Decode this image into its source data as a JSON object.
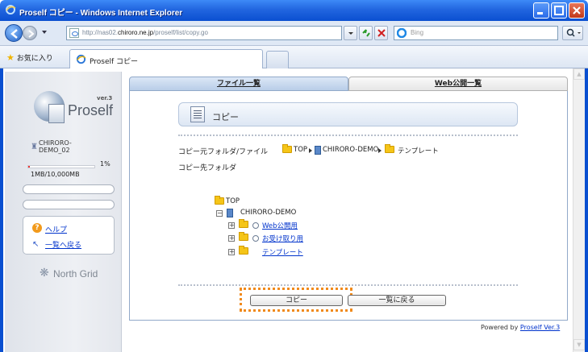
{
  "window": {
    "title": "Proself コピー - Windows Internet Explorer"
  },
  "address": {
    "url_prefix": "http://nas02.",
    "url_domain": "chiroro.ne.jp",
    "url_path": "/proself/list/copy.go"
  },
  "search": {
    "placeholder": "Bing"
  },
  "favorites": {
    "label": "お気に入り",
    "tab_label": "Proself コピー"
  },
  "sidebar": {
    "version": "ver.3",
    "logo": "Proself",
    "user_line1": "CHIRORO-",
    "user_line2": "DEMO_02",
    "quota_percent": "1%",
    "quota_fraction": 0.01,
    "quota_text": "1MB/10,000MB",
    "help_label": "ヘルプ",
    "back_label": "一覧へ戻る",
    "brand": "North Grid"
  },
  "tabs": {
    "files": "ファイル一覧",
    "web": "Web公開一覧"
  },
  "page": {
    "title": "コピー",
    "source_label": "コピー元フォルダ/ファイル",
    "breadcrumb": [
      "TOP",
      "CHIRORO-DEMO",
      "テンプレート"
    ],
    "dest_label": "コピー先フォルダ",
    "tree_root": "TOP",
    "tree_child": "CHIRORO-DEMO",
    "tree_items": [
      "Web公開用",
      "お受け取り用",
      "テンプレート"
    ],
    "copy_button": "コピー",
    "back_button": "一覧に戻る",
    "powered_prefix": "Powered by",
    "powered_link": "Proself Ver.3"
  }
}
